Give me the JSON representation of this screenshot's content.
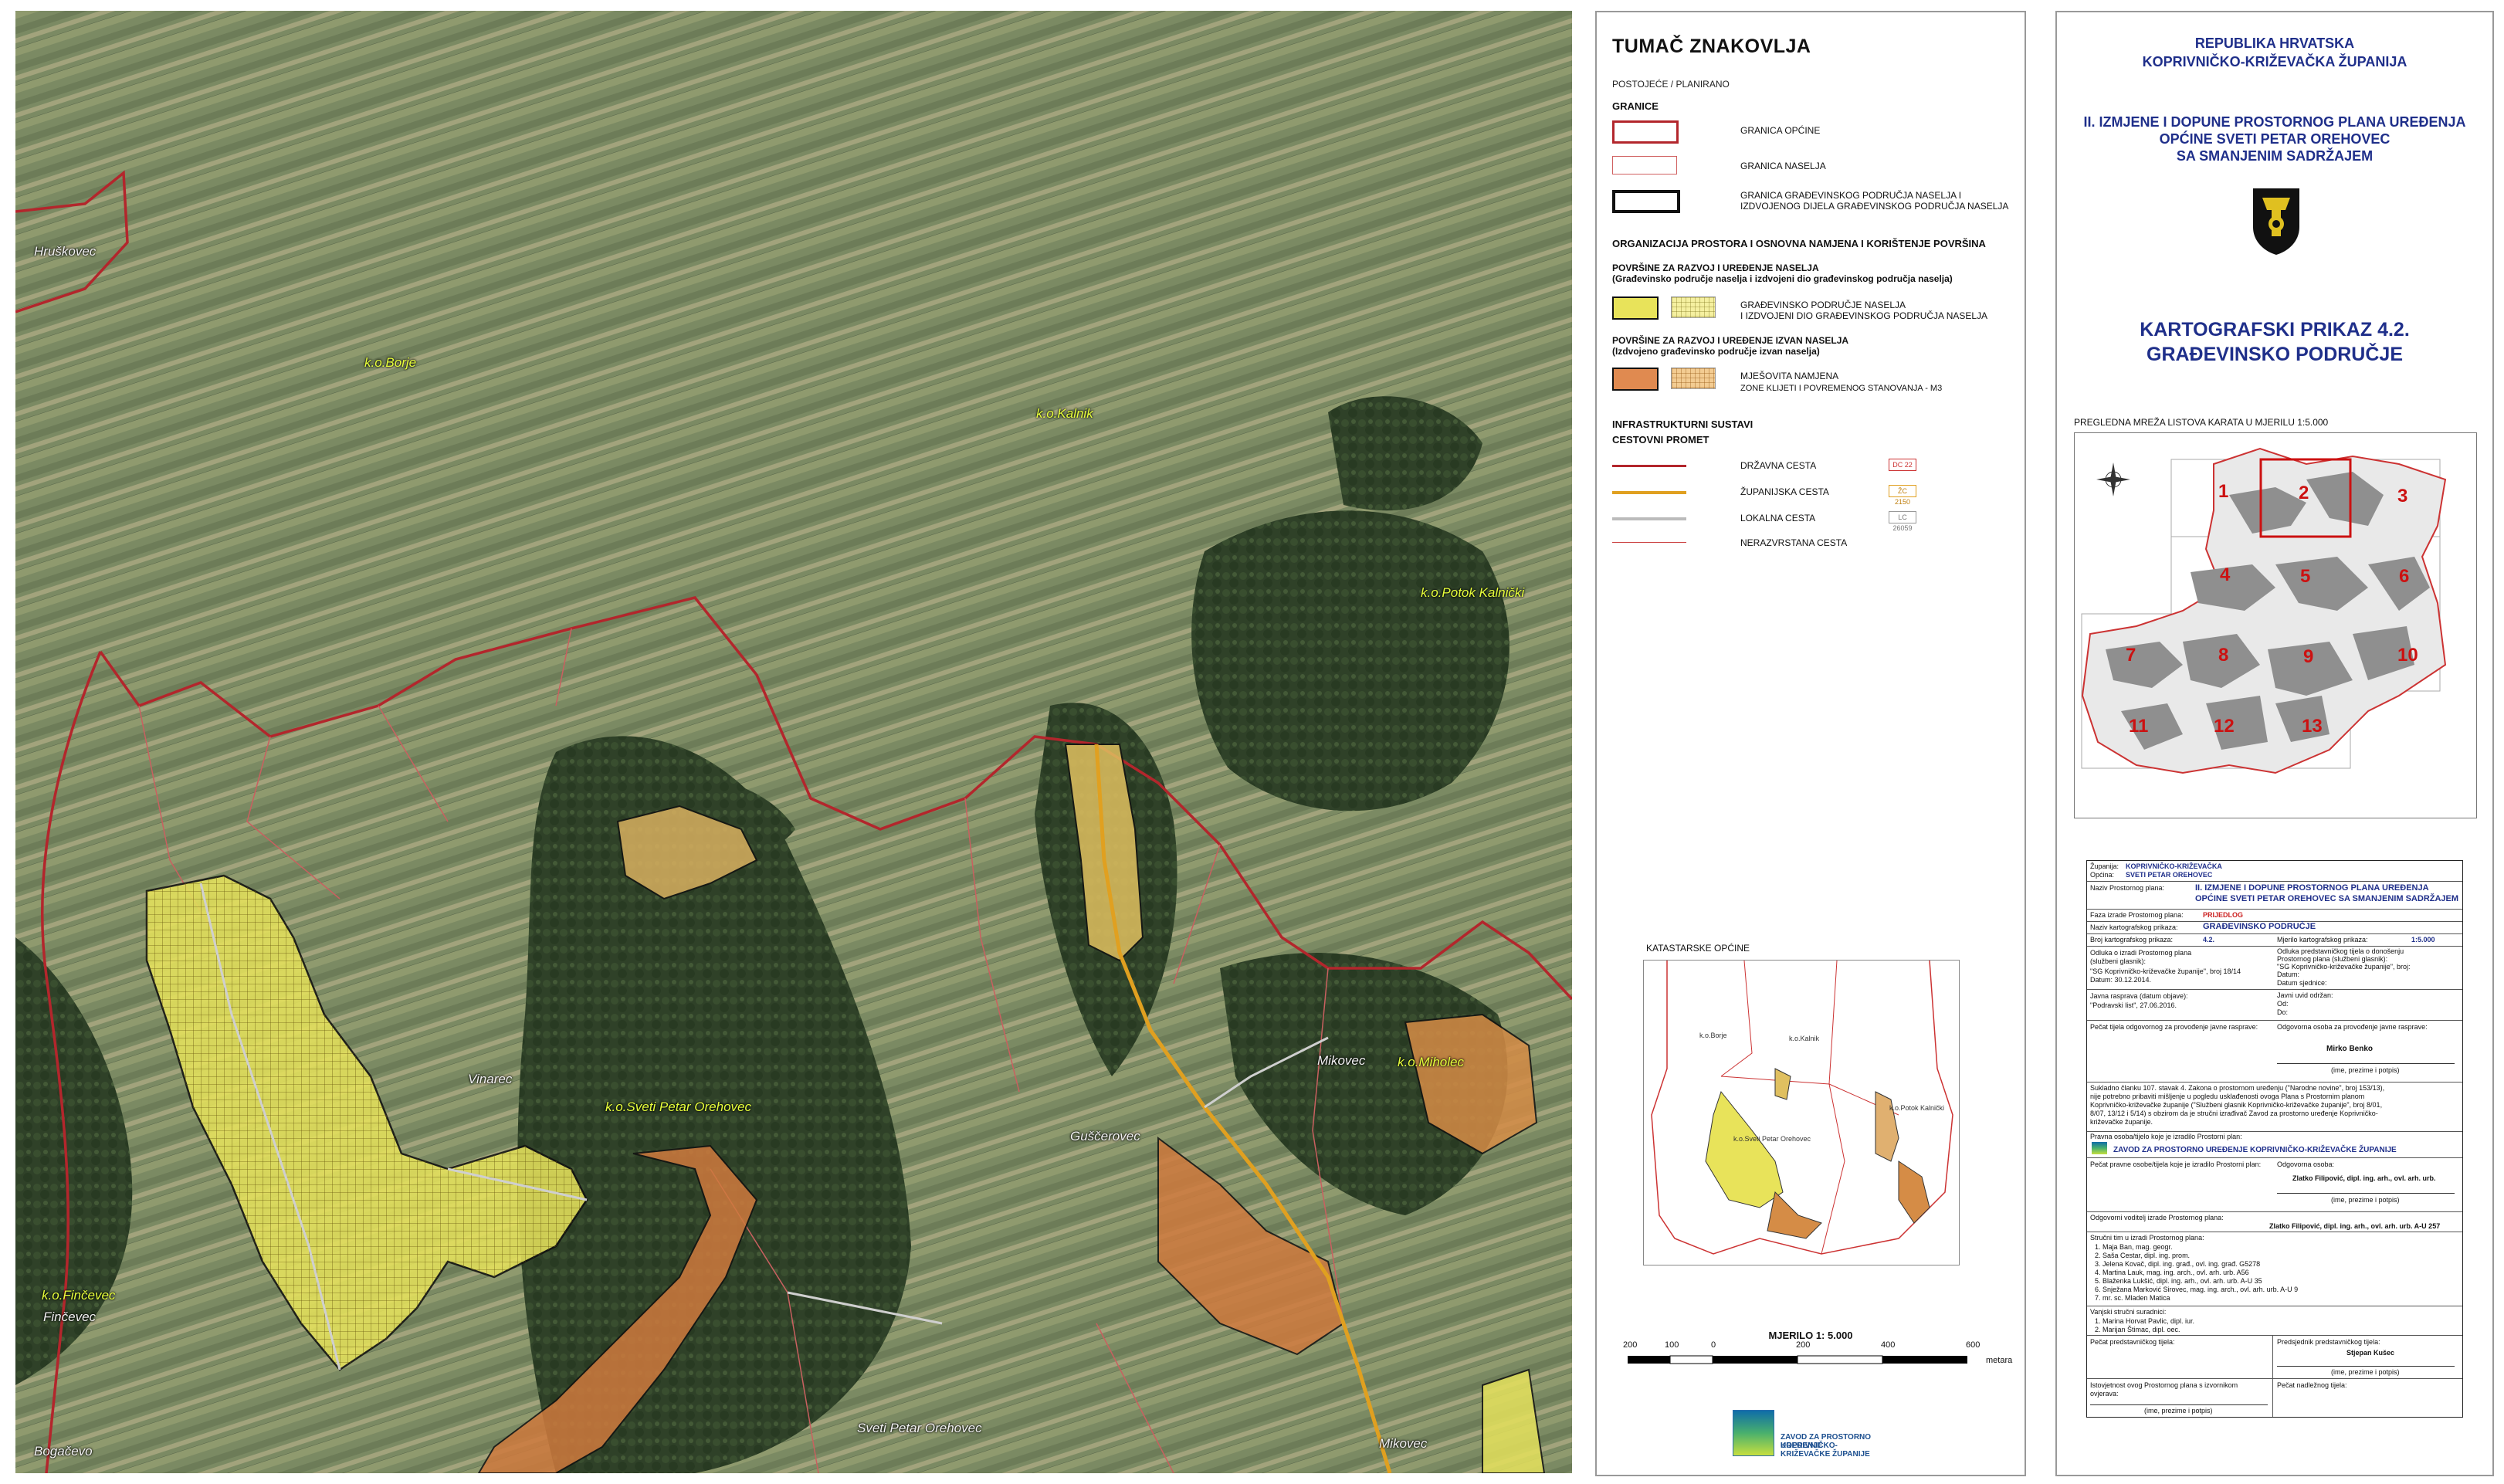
{
  "map": {
    "places": [
      "k.o.Borje",
      "k.o.Kalnik",
      "k.o.Potok Kalnički",
      "k.o.Sveti Petar Orehovec",
      "k.o.Miholec",
      "k.o.Finčevec",
      "Hruškovec",
      "Vinarec",
      "Guščerovec",
      "Mikovec",
      "Finčevec",
      "Bogačevo",
      "Sveti Petar Orehovec",
      "Mikovec"
    ],
    "colors": {
      "boundary_red": "#b3262c",
      "yellow_zone": "#e8e35a",
      "orange_zone": "#cf7a3e",
      "county_road": "#e0a020"
    }
  },
  "legend": {
    "title": "TUMAČ ZNAKOVLJA",
    "existing_planned": "POSTOJEĆE  /  PLANIRANO",
    "granice_head": "GRANICE",
    "granica_opcine": "GRANICA OPĆINE",
    "granica_naselja": "GRANICA NASELJA",
    "granica_gp_1": "GRANICA GRAĐEVINSKOG PODRUČJA NASELJA I",
    "granica_gp_2": "IZDVOJENOG DIJELA GRAĐEVINSKOG PODRUČJA NASELJA",
    "org_head": "ORGANIZACIJA PROSTORA I OSNOVNA NAMJENA I KORIŠTENJE POVRŠINA",
    "razvoj_nas_1": "POVRŠINE ZA RAZVOJ I UREĐENJE NASELJA",
    "razvoj_nas_2": "(Građevinsko područje naselja i izdvojeni dio građevinskog područja naselja)",
    "gp_naselja_1": "GRAĐEVINSKO PODRUČJE NASELJA",
    "gp_naselja_2": "I IZDVOJENI DIO GRAĐEVINSKOG PODRUČJA NASELJA",
    "izvan_1": "POVRŠINE ZA RAZVOJ I UREĐENJE IZVAN NASELJA",
    "izvan_2": "(Izdvojeno građevinsko područje izvan naselja)",
    "mjesovita": "MJEŠOVITA NAMJENA",
    "klijeti": "ZONE KLIJETI I POVREMENOG STANOVANJA - M3",
    "infra_head": "INFRASTRUKTURNI SUSTAVI",
    "cestovni_head": "CESTOVNI PROMET",
    "drzavna": "DRŽAVNA CESTA",
    "drzavna_code": "DC 22",
    "zupanijska": "ŽUPANIJSKA CESTA",
    "zupanijska_code": "ŽC 2150",
    "lokalna": "LOKALNA CESTA",
    "lokalna_code": "LC 26059",
    "nerazvrstana": "NERAZVRSTANA CESTA",
    "kat_title": "KATASTARSKE OPĆINE",
    "kat_labels": [
      "k.o.Borje",
      "k.o.Kalnik",
      "k.o.Potok Kalnički",
      "k.o.Sveti Petar Orehovec"
    ],
    "scale_caption": "MJERILO 1: 5.000",
    "scale_ticks": [
      "200",
      "100",
      "0",
      "200",
      "400",
      "600"
    ],
    "scale_unit": "metara",
    "logo_line1": "ZAVOD ZA PROSTORNO UREĐENJE",
    "logo_line2": "KOPRIVNIČKO-KRIŽEVAČKE ŽUPANIJE"
  },
  "title_block": {
    "republic": "REPUBLIKA HRVATSKA",
    "county": "KOPRIVNIČKO-KRIŽEVAČKA ŽUPANIJA",
    "plan_1": "II. IZMJENE I DOPUNE PROSTORNOG PLANA UREĐENJA",
    "plan_2": "OPĆINE SVETI PETAR OREHOVEC",
    "plan_3": "SA SMANJENIM SADRŽAJEM",
    "carto_1": "KARTOGRAFSKI PRIKAZ 4.2.",
    "carto_2": "GRAĐEVINSKO PODRUČJE",
    "overview_caption": "PREGLEDNA MREŽA LISTOVA KARATA U MJERILU 1:5.000",
    "sheet_numbers": [
      "1",
      "2",
      "3",
      "4",
      "5",
      "6",
      "7",
      "8",
      "9",
      "10",
      "11",
      "12",
      "13"
    ]
  },
  "form": {
    "zupanija_l": "Županija:",
    "zupanija_v": "KOPRIVNIČKO-KRIŽEVAČKA",
    "opcina_l": "Općina:",
    "opcina_v": "SVETI PETAR OREHOVEC",
    "naziv_plana_l": "Naziv Prostornog plana:",
    "naziv_plana_v1": "II. IZMJENE I DOPUNE PROSTORNOG PLANA UREĐENJA",
    "naziv_plana_v2": "OPĆINE SVETI PETAR OREHOVEC SA SMANJENIM SADRŽAJEM",
    "faza_l": "Faza izrade Prostornog plana:",
    "faza_v": "PRIJEDLOG",
    "naziv_kp_l": "Naziv kartografskog prikaza:",
    "naziv_kp_v": "GRAĐEVINSKO PODRUČJE",
    "broj_l": "Broj kartografskog prikaza:",
    "broj_v": "4.2.",
    "mjerilo_l": "Mjerilo kartografskog prikaza:",
    "mjerilo_v": "1:5.000",
    "odluka_1": "Odluka o izradi Prostornog plana",
    "odluka_2": "(službeni glasnik):",
    "odluka_3": "\"SG Koprivničko-križevačke županije\", broj 18/14",
    "odluka_4": "Datum: 30.12.2014.",
    "odluka_pred_1": "Odluka predstavničkog tijela o donošenju",
    "odluka_pred_2": "Prostornog plana (službeni glasnik):",
    "odluka_pred_3": "\"SG Koprivničko-križevačke županije\", broj:",
    "odluka_pred_4": "Datum:",
    "odluka_pred_5": "Datum sjednice:",
    "javna_1": "Javna rasprava (datum objave):",
    "javna_2": "\"Podravski list\", 27.06.2016.",
    "uvid_1": "Javni uvid održan:",
    "uvid_2": "Od:",
    "uvid_3": "Do:",
    "pecat_tijela": "Pečat tijela odgovornog za provođenje javne rasprave:",
    "odgovorna_l": "Odgovorna osoba za provođenje javne rasprave:",
    "odgovorna_v": "Mirko Benko",
    "ime_potpis": "(ime, prezime i potpis)",
    "suglasnost_1": "Sukladno članku 107. stavak 4. Zakona o prostornom uređenju (\"Narodne novine\", broj 153/13),",
    "suglasnost_2": "nije potrebno pribaviti mišljenje u pogledu usklađenosti ovoga Plana s Prostornim planom",
    "suglasnost_3": "Koprivničko-križevačke županije (\"Službeni glasnik Koprivničko-križevačke županije\", broj 8/01,",
    "suglasnost_4": "8/07, 13/12 i 5/14) s obzirom da je stručni izrađivač Zavod za prostorno uređenje Koprivničko-",
    "suglasnost_5": "križevačke županije.",
    "izradio_l": "Pravna osoba/tijelo koje je izradilo Prostorni plan:",
    "izradio_v": "ZAVOD ZA PROSTORNO UREĐENJE KOPRIVNIČKO-KRIŽEVAČKE ŽUPANIJE",
    "pecat_pravne": "Pečat pravne osobe/tijela koje je izradilo Prostorni plan:",
    "odgovorna2_l": "Odgovorna osoba:",
    "odgovorna2_v": "Zlatko Filipović, dipl. ing. arh., ovl. arh. urb.",
    "voditelj_l": "Odgovorni voditelj izrade Prostornog plana:",
    "voditelj_v": "Zlatko Filipović, dipl. ing. arh., ovl. arh. urb. A-U 257",
    "strucni_l": "Stručni tim u izradi Prostornog plana:",
    "strucni": [
      "1.   Maja Ban, mag. geogr.",
      "2.   Saša Cestar, dipl. ing. prom.",
      "3.   Jelena Kovač, dipl. ing. građ., ovl. ing. građ. G5278",
      "4.   Martina Lauk, mag. ing. arch., ovl. arh. urb. A56",
      "5.   Blaženka Lukšić, dipl. ing. arh., ovl. arh. urb. A-U 35",
      "6.   Snježana Marković Sirovec, mag. ing. arch., ovl. arh. urb. A-U 9",
      "7.   mr. sc. Mladen Matica"
    ],
    "vanjski_l": "Vanjski stručni suradnici:",
    "vanjski": [
      "1.   Marina Horvat Pavlic, dipl. iur.",
      "2.   Marijan Štimac, dipl. oec."
    ],
    "pecat_pred": "Pečat predstavničkog tijela:",
    "predsjednik_l": "Predsjednik predstavničkog tijela:",
    "predsjednik_v": "Stjepan Kušec",
    "istovjetnost_1": "Istovjetnost ovog Prostornog plana s izvornikom",
    "istovjetnost_2": "ovjerava:",
    "pecat_nadl": "Pečat nadležnog tijela:"
  }
}
